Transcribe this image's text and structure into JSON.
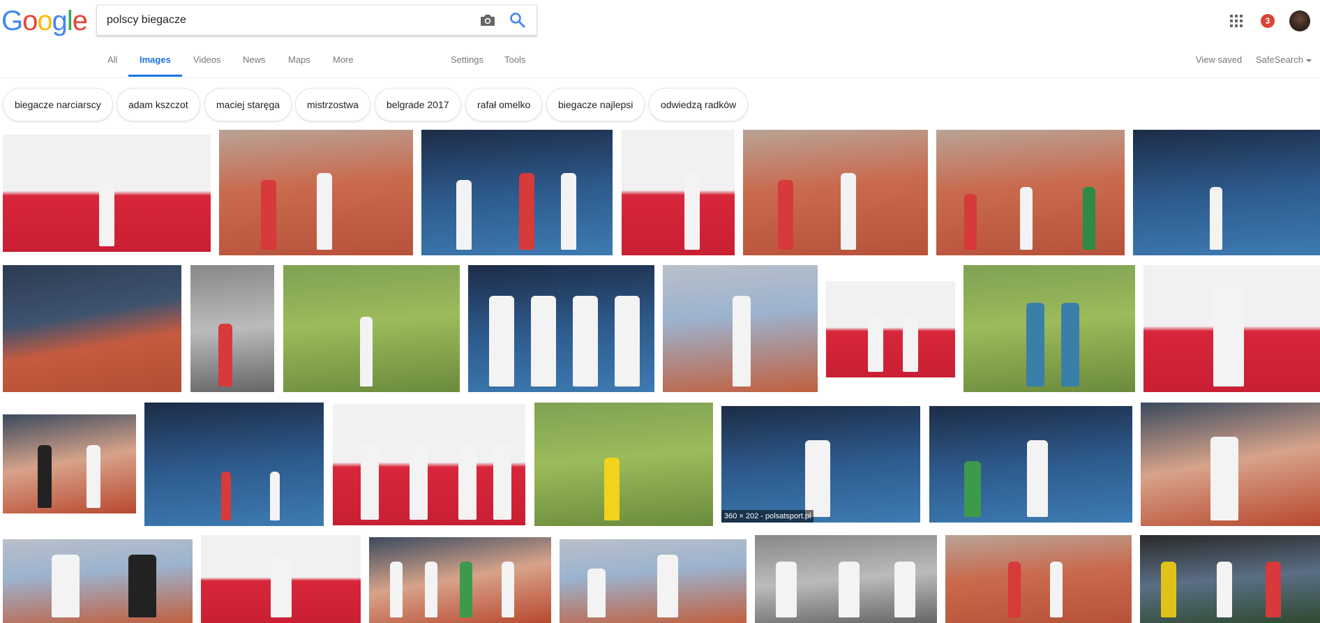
{
  "logo": {
    "letters": [
      {
        "ch": "G",
        "color": "#4285F4"
      },
      {
        "ch": "o",
        "color": "#EA4335"
      },
      {
        "ch": "o",
        "color": "#FBBC05"
      },
      {
        "ch": "g",
        "color": "#4285F4"
      },
      {
        "ch": "l",
        "color": "#34A853"
      },
      {
        "ch": "e",
        "color": "#EA4335"
      }
    ]
  },
  "search": {
    "value": "polscy biegacze",
    "camera_icon": "camera-icon",
    "search_icon": "search-icon"
  },
  "header": {
    "apps_icon": "apps-grid-icon",
    "notifications_count": "3",
    "avatar": "profile-avatar"
  },
  "nav": {
    "tabs": [
      {
        "label": "All"
      },
      {
        "label": "Images"
      },
      {
        "label": "Videos"
      },
      {
        "label": "News"
      },
      {
        "label": "Maps"
      },
      {
        "label": "More"
      }
    ],
    "active_tab": "Images",
    "settings": "Settings",
    "tools": "Tools",
    "view_saved": "View saved",
    "safesearch": "SafeSearch"
  },
  "chips": [
    {
      "label": "biegacze narciarscy"
    },
    {
      "label": "adam kszczot"
    },
    {
      "label": "maciej staręga"
    },
    {
      "label": "mistrzostwa"
    },
    {
      "label": "belgrade 2017"
    },
    {
      "label": "rafał omelko"
    },
    {
      "label": "biegacze najlepsi"
    },
    {
      "label": "odwiedzą radków"
    }
  ],
  "hovered_image": {
    "meta": "360 × 202 - polsatsport.pl"
  },
  "colors": {
    "accent": "#1a73e8",
    "badge": "#db4437"
  }
}
